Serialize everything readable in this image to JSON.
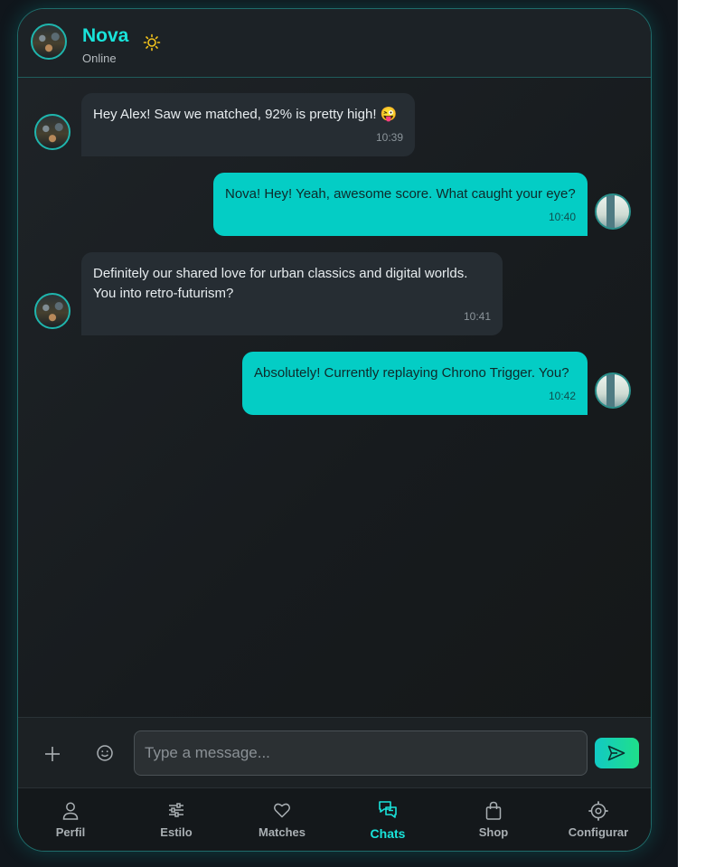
{
  "contact": {
    "name": "Nova",
    "status": "Online"
  },
  "messages": [
    {
      "side": "in",
      "text": "Hey Alex! Saw we matched, 92% is pretty high! 😜",
      "time": "10:39"
    },
    {
      "side": "out",
      "text": "Nova! Hey! Yeah, awesome score. What caught your eye?",
      "time": "10:40"
    },
    {
      "side": "in",
      "text": "Definitely our shared love for urban classics and digital worlds. You into retro-futurism?",
      "time": "10:41"
    },
    {
      "side": "out",
      "text": "Absolutely! Currently replaying Chrono Trigger. You?",
      "time": "10:42"
    }
  ],
  "composer": {
    "placeholder": "Type a message..."
  },
  "nav": {
    "items": [
      {
        "label": "Perfil",
        "icon": "person-icon"
      },
      {
        "label": "Estilo",
        "icon": "sliders-icon"
      },
      {
        "label": "Matches",
        "icon": "heart-icon"
      },
      {
        "label": "Chats",
        "icon": "chat-icon",
        "active": true
      },
      {
        "label": "Shop",
        "icon": "shopping-bag-icon"
      },
      {
        "label": "Configurar",
        "icon": "settings-icon"
      }
    ]
  },
  "colors": {
    "accent": "#19e3da",
    "outgoing_bubble": "#04cdc5",
    "incoming_bubble": "#262d33",
    "sun": "#f2c21b"
  }
}
